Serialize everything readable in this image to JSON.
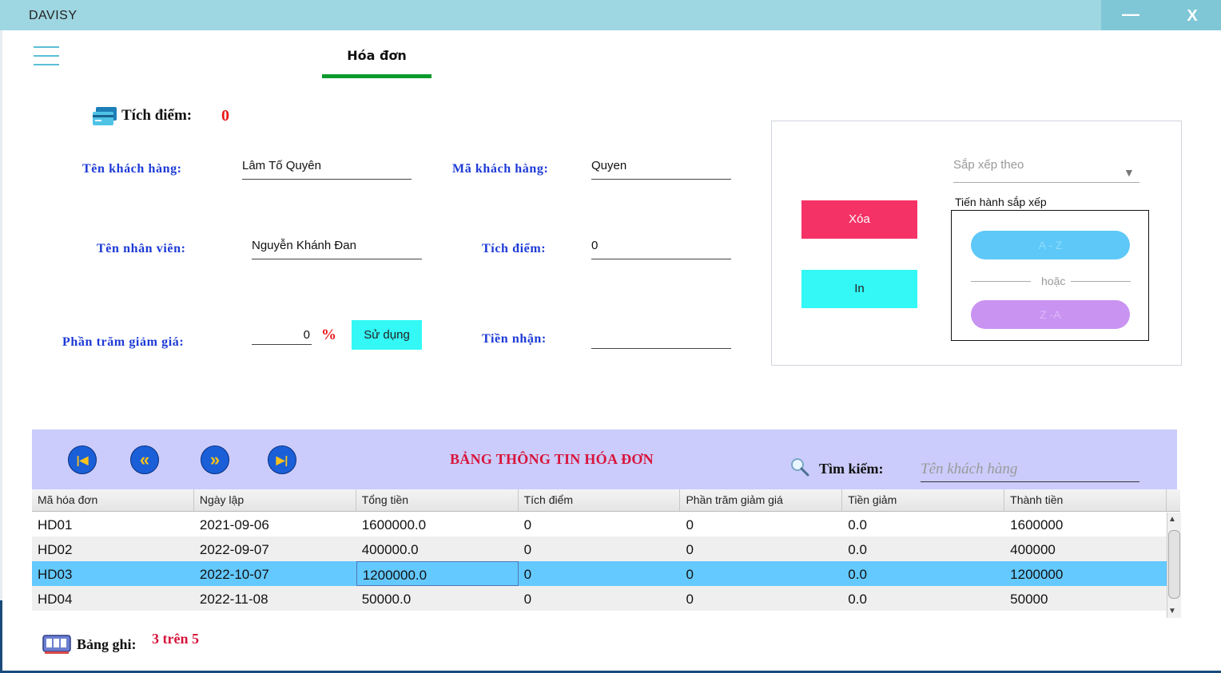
{
  "app": {
    "title": "DAVISY",
    "minimize_label": "—",
    "close_label": "X"
  },
  "tabs": [
    {
      "label": "Hóa đơn",
      "active": true
    }
  ],
  "points_header": {
    "label": "Tích điểm:",
    "value": "0"
  },
  "form": {
    "customer_name": {
      "label": "Tên khách hàng:",
      "value": "Lâm Tố Quyên"
    },
    "customer_id": {
      "label": "Mã khách hàng:",
      "value": "Quyen"
    },
    "employee_name": {
      "label": "Tên nhân viên:",
      "value": "Nguyễn Khánh Đan"
    },
    "points": {
      "label": "Tích điểm:",
      "value": "0"
    },
    "discount": {
      "label": "Phần trăm giảm giá:",
      "value": "0",
      "unit": "%",
      "apply_label": "Sử dụng"
    },
    "received": {
      "label": "Tiền nhận:",
      "value": ""
    }
  },
  "actions": {
    "delete_label": "Xóa",
    "print_label": "In"
  },
  "sort": {
    "placeholder": "Sắp xếp theo",
    "group_label": "Tiến hành sắp xếp",
    "az_label": "A - Z",
    "or_label": "hoặc",
    "za_label": "Z -A"
  },
  "table": {
    "title": "BẢNG THÔNG TIN HÓA ĐƠN",
    "search_label": "Tìm kiếm:",
    "search_placeholder": "Tên khách hàng",
    "nav": {
      "first": "|◀",
      "prev": "«",
      "next": "»",
      "last": "▶|"
    },
    "columns": [
      "Mã hóa đơn",
      "Ngày lập",
      "Tổng tiền",
      "Tích điểm",
      "Phần trăm giảm giá",
      "Tiền giảm",
      "Thành tiền"
    ],
    "rows": [
      [
        "HD01",
        "2021-09-06",
        "1600000.0",
        "0",
        "0",
        "0.0",
        "1600000"
      ],
      [
        "HD02",
        "2022-09-07",
        "400000.0",
        "0",
        "0",
        "0.0",
        "400000"
      ],
      [
        "HD03",
        "2022-10-07",
        "1200000.0",
        "0",
        "0",
        "0.0",
        "1200000"
      ],
      [
        "HD04",
        "2022-11-08",
        "50000.0",
        "0",
        "0",
        "0.0",
        "50000"
      ]
    ],
    "selected_row": 2
  },
  "footer": {
    "record_label": "Bảng ghi:",
    "record_value": "3 trên 5"
  },
  "colors": {
    "accent": "#0c9a2e",
    "delete": "#f53266",
    "print": "#33f8f6",
    "selected": "#64c9ff",
    "title_red": "#d8143c",
    "label_blue": "#1d3ad6"
  }
}
